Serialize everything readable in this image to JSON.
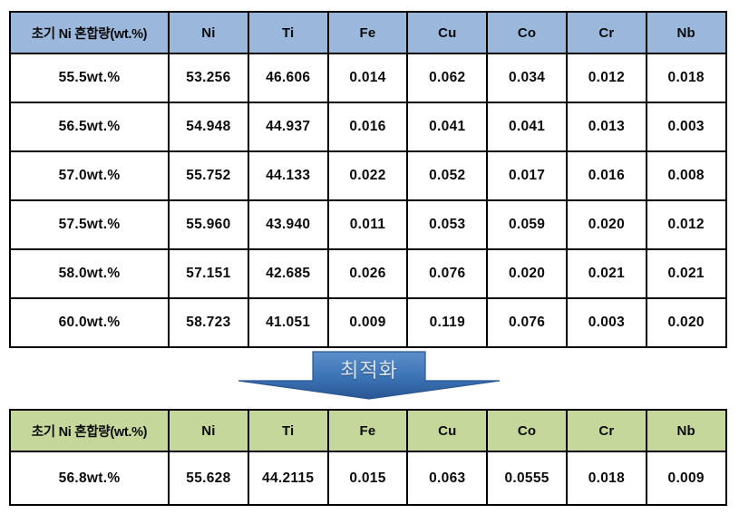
{
  "document": {
    "title": "Ni-Ti composition optimization tables",
    "colors": {
      "header_blue": "#9CB7DC",
      "header_green": "#C6D79B",
      "border": "#000000",
      "arrow_fill_top": "#5B8FCB",
      "arrow_fill_bottom": "#2E5E9E",
      "arrow_text": "#D9E4F2"
    }
  },
  "table_top": {
    "name": "initial-ni-mixing-results-table",
    "columns": [
      "초기 Ni 혼합량(wt.%)",
      "Ni",
      "Ti",
      "Fe",
      "Cu",
      "Co",
      "Cr",
      "Nb"
    ],
    "rows": [
      [
        "55.5wt.%",
        "53.256",
        "46.606",
        "0.014",
        "0.062",
        "0.034",
        "0.012",
        "0.018"
      ],
      [
        "56.5wt.%",
        "54.948",
        "44.937",
        "0.016",
        "0.041",
        "0.041",
        "0.013",
        "0.003"
      ],
      [
        "57.0wt.%",
        "55.752",
        "44.133",
        "0.022",
        "0.052",
        "0.017",
        "0.016",
        "0.008"
      ],
      [
        "57.5wt.%",
        "55.960",
        "43.940",
        "0.011",
        "0.053",
        "0.059",
        "0.020",
        "0.012"
      ],
      [
        "58.0wt.%",
        "57.151",
        "42.685",
        "0.026",
        "0.076",
        "0.020",
        "0.021",
        "0.021"
      ],
      [
        "60.0wt.%",
        "58.723",
        "41.051",
        "0.009",
        "0.119",
        "0.076",
        "0.003",
        "0.020"
      ]
    ]
  },
  "arrow": {
    "name": "optimization-arrow",
    "label": "최적화",
    "direction": "down"
  },
  "table_bottom": {
    "name": "optimized-composition-table",
    "columns": [
      "초기 Ni 혼합량(wt.%)",
      "Ni",
      "Ti",
      "Fe",
      "Cu",
      "Co",
      "Cr",
      "Nb"
    ],
    "rows": [
      [
        "56.8wt.%",
        "55.628",
        "44.2115",
        "0.015",
        "0.063",
        "0.0555",
        "0.018",
        "0.009"
      ]
    ]
  }
}
